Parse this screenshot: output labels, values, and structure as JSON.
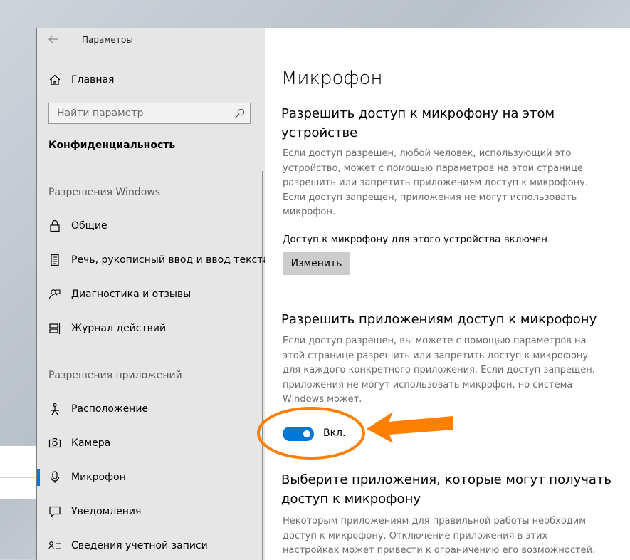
{
  "window": {
    "title": "Параметры",
    "home_label": "Главная",
    "search_placeholder": "Найти параметр",
    "category": "Конфиденциальность"
  },
  "sidebar": {
    "windows_section": "Разрешения Windows",
    "apps_section": "Разрешения приложений",
    "windows_items": [
      {
        "label": "Общие",
        "icon": "lock-icon"
      },
      {
        "label": "Речь, рукописный ввод и ввод текста",
        "icon": "document-icon"
      },
      {
        "label": "Диагностика и отзывы",
        "icon": "feedback-icon"
      },
      {
        "label": "Журнал действий",
        "icon": "timeline-icon"
      }
    ],
    "app_items": [
      {
        "label": "Расположение",
        "icon": "location-icon"
      },
      {
        "label": "Камера",
        "icon": "camera-icon"
      },
      {
        "label": "Микрофон",
        "icon": "microphone-icon",
        "selected": true
      },
      {
        "label": "Уведомления",
        "icon": "notification-icon"
      },
      {
        "label": "Сведения учетной записи",
        "icon": "account-info-icon"
      }
    ]
  },
  "main": {
    "title": "Микрофон",
    "device_access": {
      "heading": "Разрешить доступ к микрофону на этом устройстве",
      "description": "Если доступ разрешен, любой человек, использующий это устройство, может с помощью параметров на этой странице разрешить или запретить приложениям доступ к микрофону. Если доступ запрещен, приложения не могут использовать микрофон.",
      "status": "Доступ к микрофону для этого устройства включен",
      "button": "Изменить"
    },
    "app_access": {
      "heading": "Разрешить приложениям доступ к микрофону",
      "description": "Если доступ разрешен, вы можете с помощью параметров на этой странице разрешить или запретить доступ к микрофону для каждого конкретного приложения. Если доступ запрещен, приложения не могут использовать микрофон, но система Windows может.",
      "toggle_state": "on",
      "toggle_label": "Вкл."
    },
    "choose_apps": {
      "heading": "Выберите приложения, которые могут получать доступ к микрофону",
      "description": "Некоторым приложениям для правильной работы необходим доступ к микрофону. Отключение приложения в этих настройках может привести к ограничению его возможностей."
    }
  },
  "colors": {
    "accent": "#0078d7",
    "annotation": "#ff7f00",
    "sidebar_bg": "#e6e6e6"
  }
}
